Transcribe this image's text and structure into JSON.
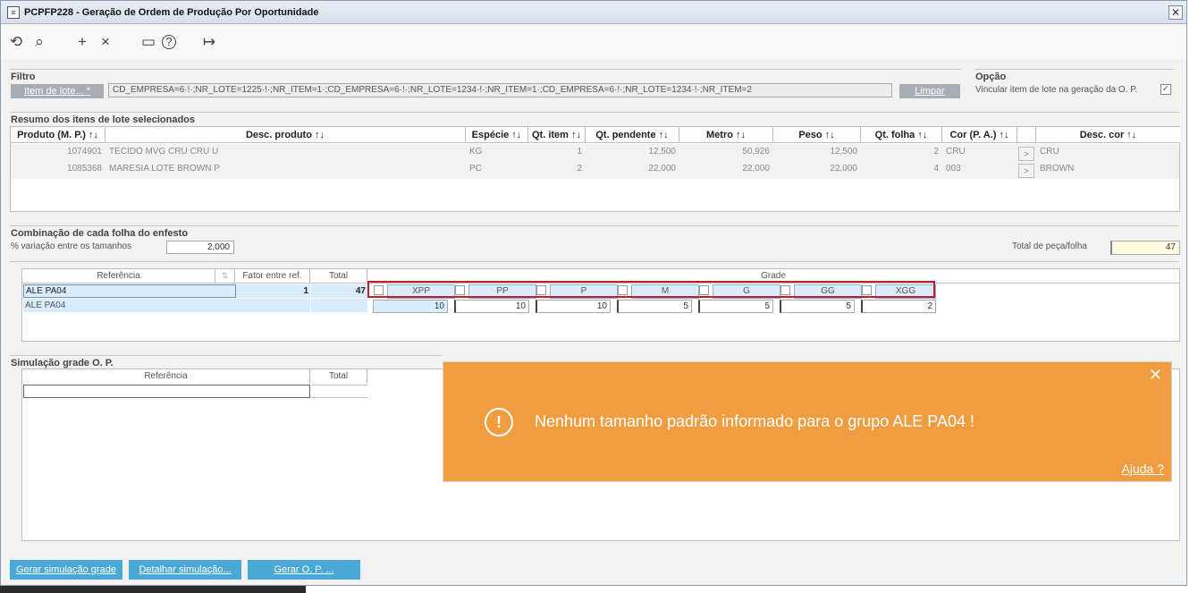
{
  "window": {
    "title": "PCPFP228 - Geração de Ordem de Produção Por Oportunidade",
    "close_label": "✕"
  },
  "toolbar": {
    "icons": [
      "undo-icon",
      "search-icon",
      "add-icon",
      "delete-icon",
      "calendar-icon",
      "help-icon",
      "exit-icon"
    ],
    "glyphs": [
      "⟲",
      "⌕",
      "+",
      "×",
      "▭",
      "?",
      "↦"
    ]
  },
  "filtro": {
    "title": "Filtro",
    "lookup_label": "Item de lote... *",
    "value": "CD_EMPRESA=6·!·;NR_LOTE=1225·!·;NR_ITEM=1·;CD_EMPRESA=6·!·;NR_LOTE=1234·!·;NR_ITEM=1·;CD_EMPRESA=6·!·;NR_LOTE=1234·!·;NR_ITEM=2",
    "clear_label": "Limpar"
  },
  "opcao": {
    "title": "Opção",
    "checkbox_label": "Vincular item de lote na geração da O. P.",
    "checked": true
  },
  "resumo": {
    "title": "Resumo dos itens de lote selecionados",
    "columns": [
      "Produto (M. P.) ↑↓",
      "Desc. produto ↑↓",
      "Espécie ↑↓",
      "Qt. item ↑↓",
      "Qt. pendente ↑↓",
      "Metro ↑↓",
      "Peso ↑↓",
      "Qt. folha ↑↓",
      "Cor (P. A.) ↑↓",
      "",
      "Desc. cor ↑↓"
    ],
    "rows": [
      {
        "produto": "1074901",
        "desc": "TECIDO MVG CRU CRU U",
        "especie": "KG",
        "qt_item": "1",
        "qt_pendente": "12,500",
        "metro": "50,926",
        "peso": "12,500",
        "qt_folha": "2",
        "cor": "CRU",
        "btn": ">",
        "desc_cor": "CRU"
      },
      {
        "produto": "1085368",
        "desc": "MARESIA LOTE BROWN P",
        "especie": "PC",
        "qt_item": "2",
        "qt_pendente": "22,000",
        "metro": "22,000",
        "peso": "22,000",
        "qt_folha": "4",
        "cor": "003",
        "btn": ">",
        "desc_cor": "BROWN"
      }
    ]
  },
  "combinacao": {
    "title": "Combinação de cada folha do enfesto",
    "variacao_label": "% variação entre os tamanhos",
    "variacao_value": "2,000",
    "total_label": "Total de peça/folha",
    "total_value": "47",
    "columns": {
      "referencia": "Referência",
      "fator": "Fator entre ref.",
      "total": "Total",
      "grade": "Grade"
    },
    "rows": [
      {
        "referencia": "ALE PA04",
        "fator": "1",
        "total": "47"
      },
      {
        "referencia": "ALE PA04",
        "fator": "",
        "total": ""
      }
    ],
    "sizes": [
      "XPP",
      "PP",
      "P",
      "M",
      "G",
      "GG",
      "XGG"
    ],
    "quantities": [
      "10",
      "10",
      "10",
      "5",
      "5",
      "5",
      "2"
    ],
    "highlight_color": "#c0202a"
  },
  "simulacao": {
    "title": "Simulação grade O. P.",
    "columns": {
      "referencia": "Referência",
      "total": "Total"
    }
  },
  "buttons": {
    "gerar_simulacao": "Gerar simulação grade",
    "detalhar": "Detalhar simulação...",
    "gerar_op": "Gerar O. P. ..."
  },
  "toast": {
    "message": "Nenhum tamanho padrão informado para o grupo ALE PA04 !",
    "icon": "!",
    "close": "✕",
    "help_link": "Ajuda ?",
    "color": "#f09c40"
  }
}
